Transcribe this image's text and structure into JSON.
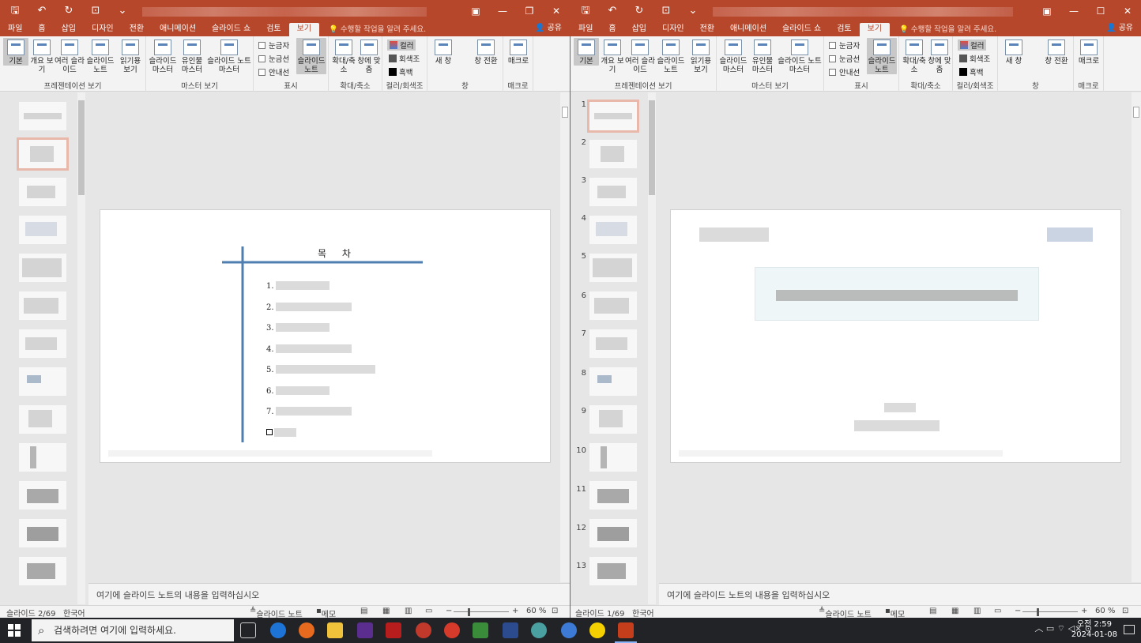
{
  "windows": [
    {
      "id": "left",
      "ribbon_tabs": [
        "파일",
        "홈",
        "삽입",
        "디자인",
        "전환",
        "애니메이션",
        "슬라이드 쇼",
        "검토",
        "보기"
      ],
      "active_tab": "보기",
      "tell_me": "수행할 작업을 알려 주세요.",
      "share": "공유",
      "groups": {
        "presentation_views": {
          "name": "프레젠테이션 보기",
          "buttons": [
            "기본",
            "개요 보기",
            "여러 슬라이드",
            "슬라이드 노트",
            "읽기용 보기"
          ]
        },
        "master_views": {
          "name": "마스터 보기",
          "buttons": [
            "슬라이드 마스터",
            "유인물 마스터",
            "슬라이드 노트 마스터"
          ]
        },
        "show": {
          "name": "표시",
          "checks": [
            "눈금자",
            "눈금선",
            "안내선"
          ],
          "button": "슬라이드 노트"
        },
        "zoom": {
          "name": "확대/축소",
          "buttons": [
            "확대/축소",
            "창에 맞춤"
          ]
        },
        "color": {
          "name": "컬러/회색조",
          "items": [
            "컬러",
            "회색조",
            "흑백"
          ]
        },
        "window": {
          "name": "창",
          "buttons": [
            "새 창",
            "창 전환"
          ]
        },
        "macro": {
          "name": "매크로",
          "buttons": [
            "매크로"
          ]
        }
      },
      "slide_title": "목 차",
      "list_numbers": [
        "1.",
        "2.",
        "3.",
        "4.",
        "5.",
        "6.",
        "7."
      ],
      "notes_placeholder": "여기에 슬라이드 노트의 내용을 입력하십시오",
      "status": {
        "slide": "슬라이드 2/69",
        "language": "한국어",
        "notes": "슬라이드 노트",
        "comments": "메모",
        "zoom": "60 %"
      }
    },
    {
      "id": "right",
      "ribbon_tabs": [
        "파일",
        "홈",
        "삽입",
        "디자인",
        "전환",
        "애니메이션",
        "슬라이드 쇼",
        "검토",
        "보기"
      ],
      "active_tab": "보기",
      "tell_me": "수행할 작업을 알려 주세요.",
      "share": "공유",
      "thumb_numbers": [
        "1",
        "2",
        "3",
        "4",
        "5",
        "6",
        "7",
        "8",
        "9",
        "10",
        "11",
        "12",
        "13"
      ],
      "notes_placeholder": "여기에 슬라이드 노트의 내용을 입력하십시오",
      "status": {
        "slide": "슬라이드 1/69",
        "language": "한국어",
        "notes": "슬라이드 노트",
        "comments": "메모",
        "zoom": "60 %"
      }
    }
  ],
  "taskbar": {
    "search_placeholder": "검색하려면 여기에 입력하세요.",
    "time": "오전 2:59",
    "date": "2024-01-08"
  },
  "colors": {
    "accent": "#b7472a",
    "ribbon": "#f3f3f3",
    "workspace": "#e6e6e6",
    "taskbar": "#212327",
    "slide_line": "#4f7fb0"
  }
}
